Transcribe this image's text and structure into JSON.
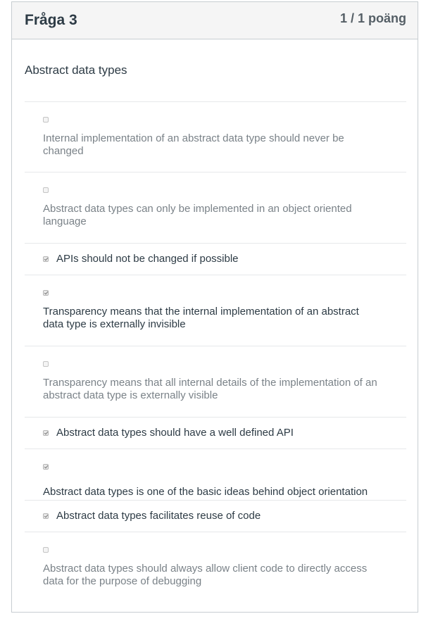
{
  "header": {
    "title": "Fråga 3",
    "points": "1 / 1 poäng"
  },
  "question": {
    "text": "Abstract data types"
  },
  "answers": [
    {
      "text": "Internal implementation of an abstract data type should never be changed",
      "checked": false
    },
    {
      "text": "Abstract data types can only be implemented in an object oriented language",
      "checked": false
    },
    {
      "text": "APIs should not be changed if possible",
      "checked": true
    },
    {
      "text": "Transparency means that the internal implementation of an abstract data type is externally invisible",
      "checked": true
    },
    {
      "text": "Transparency means that all internal details of the implementation of an abstract data type is externally visible",
      "checked": false
    },
    {
      "text": "Abstract data types should have a well defined API",
      "checked": true
    },
    {
      "text": "Abstract data types is one of the basic ideas behind object orientation",
      "checked": true
    },
    {
      "text": "Abstract data types facilitates reuse of code",
      "checked": true
    },
    {
      "text": "Abstract data types should always allow client code to directly access data for the purpose of debugging",
      "checked": false
    }
  ]
}
